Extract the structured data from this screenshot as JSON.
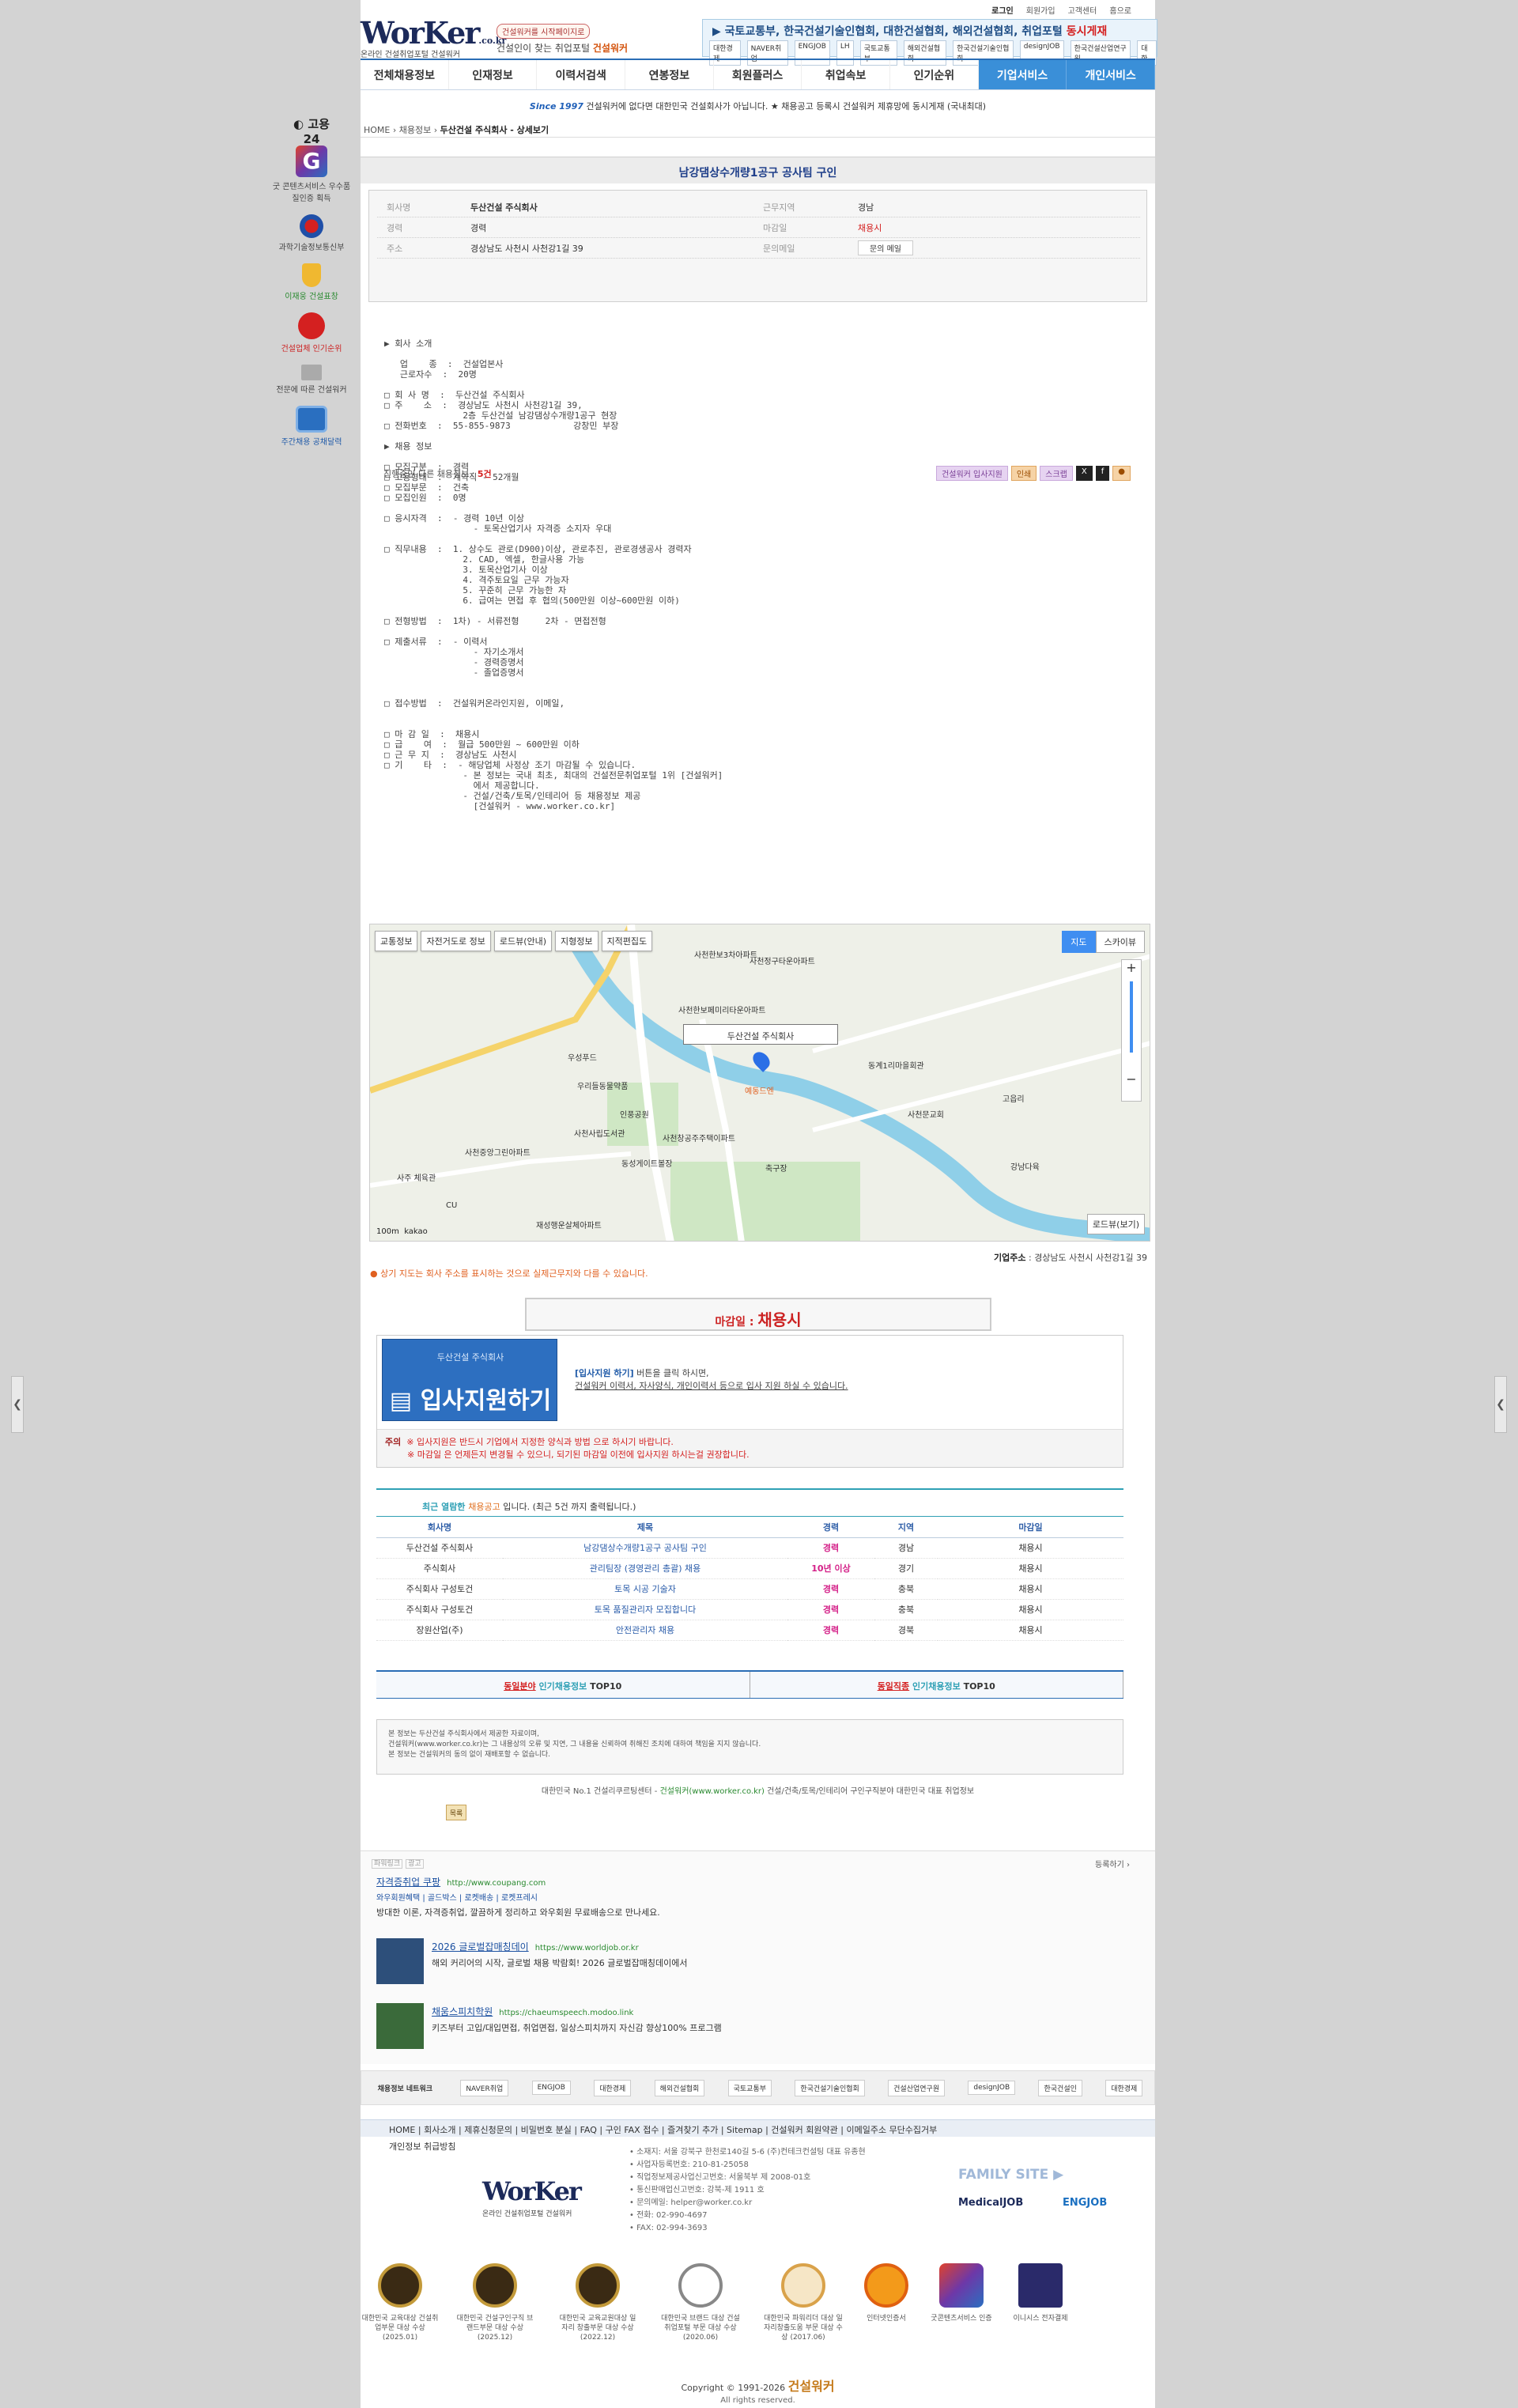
{
  "header": {
    "top_links": [
      "로그인",
      "회원가입",
      "고객센터",
      "홈으로"
    ],
    "logo": "WorKer",
    "logo_suffix": ".co.kr",
    "logo_tag": "온라인 건설취업포털 건설워커",
    "slogan_pill": "건설워커를 시작페이지로",
    "slogan_prefix": "건설인이 찾는 취업포털",
    "slogan_brand": "건설워커",
    "banner_text": "▶ 국토교통부, 한국건설기술인협회, 대한건설협회, 해외건설협회, 취업포털",
    "banner_emph": "동시게재",
    "banner_logos": [
      "대한경제",
      "NAVER취업",
      "ENGJOB",
      "LH",
      "국토교통부",
      "해외건설협회",
      "한국건설기술인협회",
      "designJOB",
      "한국건설산업연구원",
      "대한"
    ]
  },
  "nav": [
    "전체채용정보",
    "인재정보",
    "이력서검색",
    "연봉정보",
    "회원플러스",
    "취업속보",
    "인기순위",
    "기업서비스",
    "개인서비스"
  ],
  "notice": {
    "since": "Since 1997",
    "text": " 건설워커에 없다면 대한민국 건설회사가 아닙니다. ★ 채용공고 등록시 건설워커 제휴망에 동시게재 (국내최대)"
  },
  "breadcrumb": {
    "home": "HOME",
    "sep": "›",
    "c1": "채용정보",
    "current": "두산건설 주식회사 - 상세보기"
  },
  "sidebar": [
    {
      "label": "고용24"
    },
    {
      "label": "굿 콘텐츠서비스 우수품질인증 획득"
    },
    {
      "label": "과학기술정보통신부"
    },
    {
      "label": "이재웅 건설표창"
    },
    {
      "label": "건설업체 인기순위"
    },
    {
      "label": "전문에 따른 건설워커"
    },
    {
      "label": "주간채용 공채달력"
    }
  ],
  "job": {
    "title": "남강댐상수개량1공구 공사팀 구인",
    "info": {
      "company_k": "회사명",
      "company_v": "두산건설 주식회사",
      "location_k": "근무지역",
      "location_v": "경남",
      "career_k": "경력",
      "career_v": "경력",
      "deadline_k": "마감일",
      "deadline_v": "채용시",
      "addr_k": "주소",
      "addr_v": "경상남도 사천시 사천강1길 39",
      "mail_k": "문의메일",
      "mail_btn": "문의 메일"
    },
    "ongoing_prefix": "진행중인 다른 채용정보 : ",
    "ongoing_count": "5건",
    "actions": [
      "건설워커 입사지원",
      "인쇄",
      "스크랩"
    ],
    "body_text": "▶ 회사 소개\n\n   업    종  :  건설업본사\n   근로자수  :  20명\n\n□ 회 사 명  :  두산건설 주식회사\n□ 주    소  :  경상남도 사천시 사천강1길 39,\n               2층 두산건설 남강댐상수개량1공구 현장\n□ 전화번호  :  55-855-9873            강창민 부장\n\n▶ 채용 정보\n\n□ 모집구분  :  경력\n□ 고용형태  :  계약직 - 52개월\n□ 모집부문  :  건축\n□ 모집인원  :  0명\n\n□ 응시자격  :  - 경력 10년 이상\n                 - 토목산업기사 자격증 소지자 우대\n\n□ 직무내용  :  1. 상수도 관로(D900)이상, 관로추진, 관로경생공사 경력자\n               2. CAD, 엑셀, 한글사용 가능\n               3. 토목산업기사 이상\n               4. 격주토요일 근무 가능자\n               5. 꾸준히 근무 가능한 자\n               6. 급여는 면접 후 협의(500만원 이상~600만원 이하)\n\n□ 전형방법  :  1차) - 서류전형     2차 - 면접전형\n\n□ 제출서류  :  - 이력서\n                 - 자기소개서\n                 - 경력증명서\n                 - 졸업증명서\n\n\n□ 접수방법  :  건설워커온라인지원, 이메일,\n\n\n□ 마 감 일  :  채용시\n□ 급    여  :  월급 500만원 ~ 600만원 이하\n□ 근 무 지  :  경상남도 사천시\n□ 기    타  :  - 해당업체 사정상 조기 마감될 수 있습니다.\n               - 본 정보는 국내 최초, 최대의 건설전문취업포털 1위 [건설워커]\n                 에서 제공합니다.\n               - 건설/건축/토목/인테리어 등 채용정보 제공\n                 [건설워커 - www.worker.co.kr]"
  },
  "map": {
    "tools": [
      "교통정보",
      "자전거도로 정보",
      "로드뷰(안내)",
      "지형정보",
      "지적편집도"
    ],
    "types": [
      "지도",
      "스카이뷰"
    ],
    "marker_label": "두산건설 주식회사",
    "places": [
      "사천한보3차아파트",
      "사천정구타운아파트",
      "사천한보페미리타운아파트",
      "우성푸드",
      "우리들동물약품",
      "동계1리마을회관",
      "고읍리",
      "사천문교회",
      "사천사립도서관",
      "인풍공원",
      "사천동사무소앞상가",
      "사천창공주주택이파트",
      "동성게이트볼장",
      "축구장",
      "강남다육",
      "사천중앙그린아파트",
      "사주 체육관",
      "CU",
      "재성행운살체아파트",
      "예동드엔"
    ],
    "roadview": "로드뷰(보기)",
    "scale": "100m",
    "brand": "kakao"
  },
  "biz_addr": {
    "label": "기업주소",
    "value": "경상남도 사천시 사천강1길 39"
  },
  "map_note": "상기 지도는 회사 주소를 표시하는 것으로 실제근무지와 다를 수 있습니다.",
  "deadline": {
    "label": "마감일 : ",
    "value": "채용시"
  },
  "apply": {
    "company": "두산건설 주식회사",
    "button": "입사지원하기",
    "line1_b": "[입사지원 하기]",
    "line1": " 버튼을 클릭 하시면,",
    "line2": "건설워커 이력서, 자사양식, 개인이력서 등으로 입사 지원 하실 수 있습니다.",
    "warn_label": "주의",
    "warn1": "※ 입사지원은 반드시 기업에서 지정한 양식과 방법 으로 하시기 바랍니다.",
    "warn2": "※ 마감일 은 언제든지 변경될 수 있으니, 되기된 마감일 이전에 입사지원 하시는걸 권장합니다."
  },
  "recent": {
    "head_prefix": "최근 열람한 ",
    "head_emph": "채용공고",
    "head_suffix": " 입니다.   (최근 5건 까지 출력됩니다.)",
    "columns": [
      "회사명",
      "제목",
      "경력",
      "지역",
      "마감일"
    ],
    "rows": [
      [
        "두산건설 주식회사",
        "남강댐상수개량1공구 공사팀 구인",
        "경력",
        "경남",
        "채용시"
      ],
      [
        "주식회사",
        "관리팀장 (경영관리 총괄) 채용",
        "10년 이상",
        "경기",
        "채용시"
      ],
      [
        "주식회사 구성토건",
        "토목 시공 기술자",
        "경력",
        "충북",
        "채용시"
      ],
      [
        "주식회사 구성토건",
        "토목 품질관리자 모집합니다",
        "경력",
        "충북",
        "채용시"
      ],
      [
        "장원산업(주)",
        "안전관리자 채용",
        "경력",
        "경북",
        "채용시"
      ]
    ]
  },
  "top10": [
    {
      "a": "동일분야",
      "b": "인기채용정보",
      "c": " TOP10"
    },
    {
      "a": "동일직종",
      "b": "인기채용정보",
      "c": " TOP10"
    }
  ],
  "disclaimer": [
    "본 정보는 두산건설 주식회사에서 제공한 자료이며,",
    "건설워커(www.worker.co.kr)는 그 내용상의 오류 및 지연, 그 내용을 신뢰하여 취해진 조치에 대하여 책임을 지지 않습니다.",
    "본 정보는 건설워커의 동의 없이 재배포할 수 없습니다."
  ],
  "disclaimer_note": {
    "a": "대한민국 No.1 건설리쿠르팅센터 - ",
    "b": "건설워커(www.worker.co.kr)",
    "c": " 건설/건축/토목/인테리어 구인구직분야 대한민국 대표 취업정보"
  },
  "list_button": "목록",
  "power": {
    "head": "파워링크",
    "ad": "광고",
    "register": "등록하기 ›",
    "items": [
      {
        "title": "자격증취업 쿠팡",
        "url": "http://www.coupang.com",
        "sub": "와우회원혜택 | 골드박스 | 로켓배송 | 로켓프레시",
        "desc": "방대한 이론, 자격증취업, 깔끔하게 정리하고 와우회원 무료배송으로 만나세요."
      },
      {
        "title": "2026 글로벌잡매칭데이",
        "url": "https://www.worldjob.or.kr",
        "desc": "해외 커리어의 시작, 글로벌 채용 박람회! 2026 글로벌잡매칭데이에서"
      },
      {
        "title": "채움스피치학원",
        "url": "https://chaeumspeech.modoo.link",
        "desc": "키즈부터 고입/대입면접, 취업면접, 일상스피치까지 자신감 향상100% 프로그램"
      }
    ]
  },
  "partners": [
    "채용정보 네트워크",
    "NAVER취업",
    "ENGJOB",
    "대한경제",
    "해외건설협회",
    "국토교통부",
    "한국건설기술인협회",
    "건설산업연구원",
    "designJOB",
    "한국건설인",
    "대한경제"
  ],
  "footer": {
    "nav": "HOME | 회사소개 | 제휴신청문의 | 비밀번호 분실 | FAQ | 구인 FAX 접수 | 즐겨찾기 추가 | Sitemap | 건설워커 회원약관 | 이메일주소 무단수집거부",
    "privacy": "개인정보 취급방침",
    "logo": "WorKer",
    "logo_tag": "온라인 건설취업포털 건설워커",
    "info": [
      "• 소재지: 서울 강북구 한천로140길 5-6 (주)컨테크컨설팅 대표 유종현",
      "• 사업자등록번호: 210-81-25058",
      "• 직업정보제공사업신고번호: 서울북부 제 2008-01호",
      "• 통신판매업신고번호: 강북-제 1911 호",
      "• 문의메일: helper@worker.co.kr",
      "• 전화: 02-990-4697",
      "• FAX: 02-994-3693"
    ],
    "family": "FAMILY SITE ▶",
    "mjob": "MedicalJOB",
    "ejob": "ENGJOB",
    "awards": [
      "대한민국 교육대상 건설취업부문 대상 수상 (2025.01)",
      "대한민국 건설구인구직 브랜드부문 대상 수상 (2025.12)",
      "대한민국 교육교원대상 일자리 창출부문 대상 수상 (2022.12)",
      "대한민국 브랜드 대상 건설취업포털 부문 대상 수상 (2020.06)",
      "대한민국 파워리더 대상 일자리창출도움 부문 대상 수상 (2017.06)",
      "인터넷인증서",
      "굿콘텐츠서비스 인증",
      "이니시스 전자결제"
    ],
    "copyright": "Copyright © 1991-2026 ",
    "copyright_brand": "건설워커",
    "rights": "All rights reserved."
  }
}
